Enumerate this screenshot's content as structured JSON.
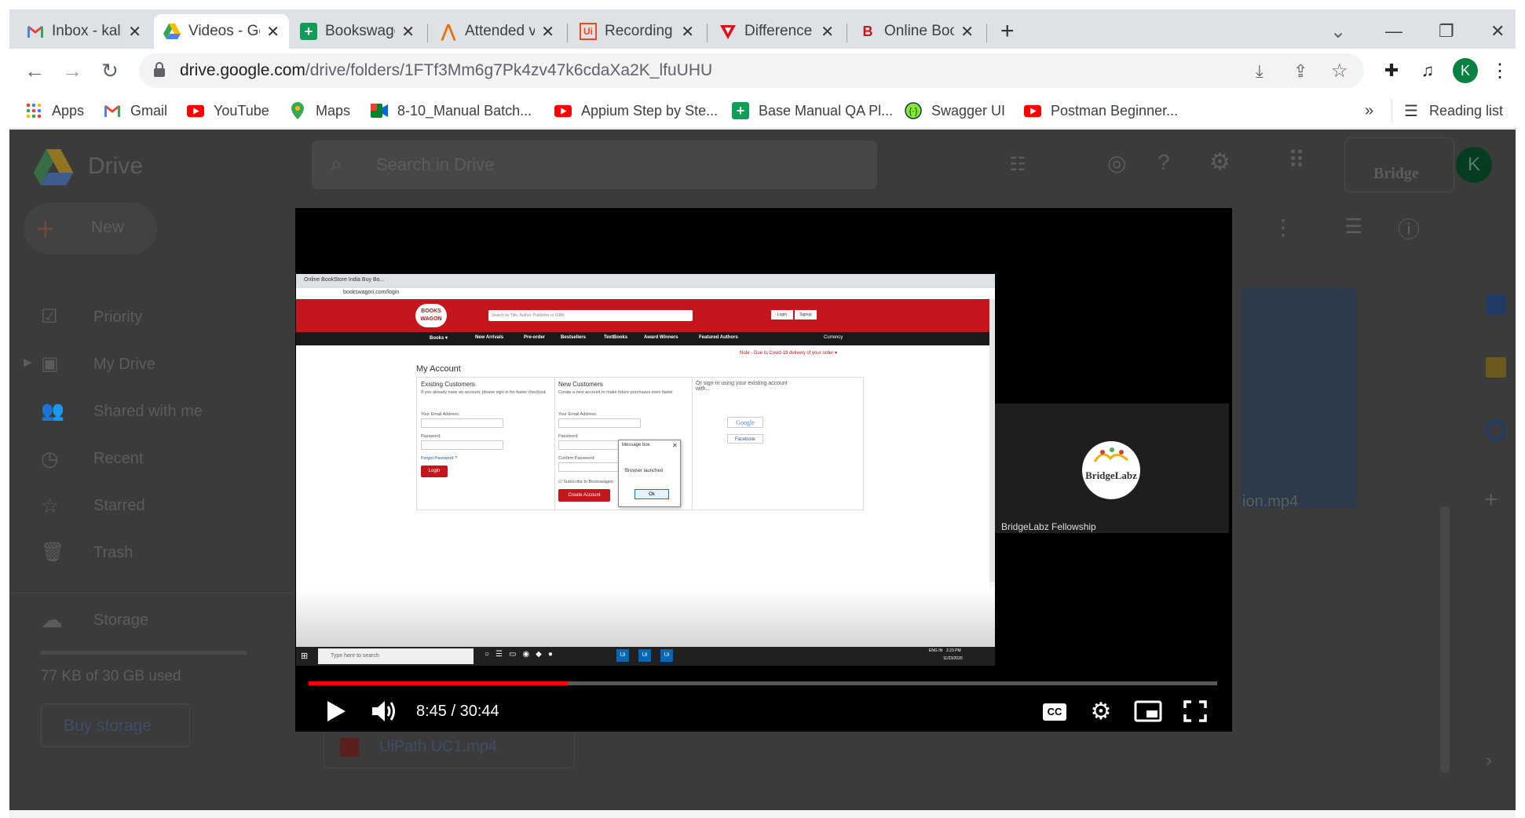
{
  "tabs": [
    {
      "title": "Inbox - kalpesh",
      "icon": "gmail-icon"
    },
    {
      "title": "Videos - Googl",
      "icon": "drive-icon"
    },
    {
      "title": "BookswagonC",
      "icon": "sheets-icon"
    },
    {
      "title": "Attended vs Ur",
      "icon": "attended-icon"
    },
    {
      "title": "Recording",
      "icon": "uipath-icon"
    },
    {
      "title": "Difference bet",
      "icon": "tosca-icon"
    },
    {
      "title": "Online BookSto",
      "icon": "bookswagon-icon"
    }
  ],
  "new_tab_label": "+",
  "window_controls": {
    "minimize": "—",
    "restore": "❐",
    "close": "✕",
    "dropdown": "⌄"
  },
  "address_bar": {
    "domain": "drive.google.com",
    "path": "/drive/folders/1FTf3Mm6g7Pk4zv47k6cdaXa2K_lfuUHU"
  },
  "profile_initial": "K",
  "bookmarks": [
    {
      "label": "Apps",
      "icon": "apps-grid-icon"
    },
    {
      "label": "Gmail",
      "icon": "gmail-icon"
    },
    {
      "label": "YouTube",
      "icon": "youtube-icon"
    },
    {
      "label": "Maps",
      "icon": "maps-icon"
    },
    {
      "label": "8-10_Manual Batch...",
      "icon": "meet-icon"
    },
    {
      "label": "Appium Step by Ste...",
      "icon": "youtube-icon"
    },
    {
      "label": "Base Manual QA Pl...",
      "icon": "sheets-icon"
    },
    {
      "label": "Swagger UI",
      "icon": "swagger-icon"
    },
    {
      "label": "Postman Beginner...",
      "icon": "youtube-icon"
    }
  ],
  "bookmarks_overflow": "»",
  "reading_list": "Reading list",
  "drive": {
    "logo_text": "Drive",
    "search_placeholder": "Search in Drive",
    "new_button": "New",
    "nav": [
      "Priority",
      "My Drive",
      "Shared with me",
      "Recent",
      "Starred",
      "Trash"
    ],
    "storage_label": "Storage",
    "storage_used": "77 KB of 30 GB used",
    "buy_storage": "Buy storage",
    "file_partial": "ion.mp4",
    "file_item": "UiPath UC1.mp4",
    "brand_text": "Bridge",
    "avatar_initial": "K"
  },
  "video": {
    "time": "8:45 / 30:44",
    "progress_fraction": 0.285,
    "cc_label": "CC",
    "participant_name": "BridgeLabz Fellowship",
    "participant_logo": "BridgeLabz",
    "inner": {
      "tab_title": "Online BookStore India Buy Bo...",
      "url": "bookswagon.com/login",
      "logo": "BOOKS WAGON",
      "search_placeholder": "Search by Title, Author, Publisher or ISBN",
      "login": "Login",
      "signup": "Signup",
      "nav": [
        "Books ▾",
        "New Arrivals",
        "Pre-order",
        "Bestsellers",
        "TextBooks",
        "Award Winners",
        "Featured Authors"
      ],
      "currency": "Currency",
      "covid_note": "Note - Due to Covid-19 delivery of your order ▾",
      "my_account": "My Account",
      "existing_title": "Existing Customers",
      "existing_desc": "If you already have an account, please sign in for faster checkout.",
      "email_label": "Your Email Address:",
      "password_label": "Password:",
      "forgot": "Forgot Password ?",
      "login_btn": "Login",
      "new_title": "New Customers",
      "new_desc": "Create a new account to make future purchases even faster",
      "confirm_label": "Confirm Password:",
      "subscribe": "Subscribe to Bookswagon",
      "create_btn": "Create Account",
      "or_signin": "Or sign-in using your existing account with...",
      "google": "Google",
      "facebook": "Facebook",
      "msgbox_title": "Message box",
      "msgbox_text": "Browser launched",
      "msgbox_ok": "Ok",
      "taskbar_search": "Type here to search",
      "tray_time": "2:23 PM",
      "tray_date": "11/23/2020",
      "tray_lang": "ENG IN"
    }
  }
}
